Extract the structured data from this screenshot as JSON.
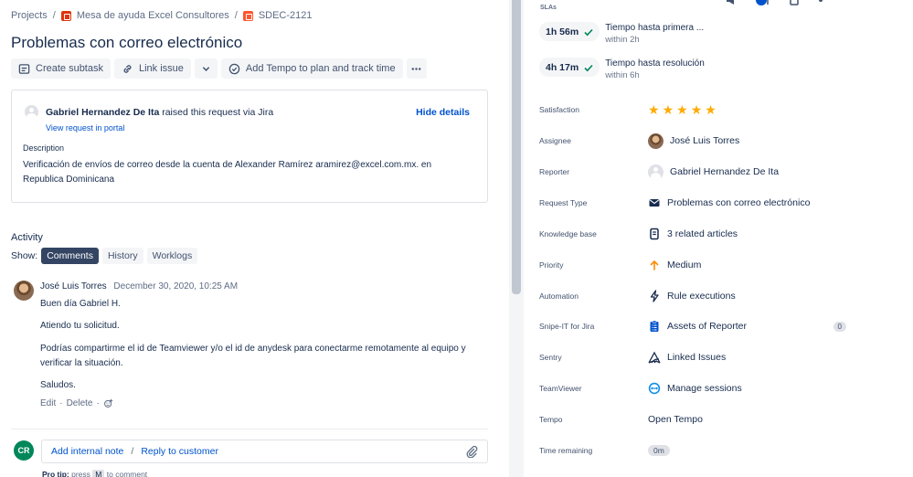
{
  "breadcrumbs": {
    "projects": "Projects",
    "project": "Mesa de ayuda Excel Consultores",
    "issue_key": "SDEC-2121"
  },
  "issue": {
    "title": "Problemas con correo electrónico"
  },
  "toolbar": {
    "create_subtask": "Create subtask",
    "link_issue": "Link issue",
    "tempo": "Add Tempo to plan and track time"
  },
  "details": {
    "reporter": "Gabriel Hernandez De Ita",
    "raised_text": "raised this request via",
    "channel": "Jira",
    "view_portal": "View request in portal",
    "hide_details": "Hide details",
    "description_label": "Description",
    "description": "Verificación de envíos de correo desde la cuenta de Alexander Ramírez aramirez@excel.com.mx. en Republica Dominicana"
  },
  "activity": {
    "label": "Activity",
    "show_label": "Show:",
    "tabs": [
      "Comments",
      "History",
      "Worklogs"
    ],
    "comment": {
      "author": "José Luis Torres",
      "date": "December 30, 2020, 10:25 AM",
      "lines": [
        "Buen día Gabriel H.",
        "Atiendo tu solicitud.",
        "Podrías compartirme el id de Teamviewer y/o el id de anydesk para conectarme remotamente al equipo y verificar la situación.",
        "Saludos."
      ],
      "edit": "Edit",
      "delete": "Delete",
      "dot": "·"
    }
  },
  "reply": {
    "avatar_initials": "CR",
    "internal_note": "Add internal note",
    "separator": "/",
    "reply_customer": "Reply to customer",
    "protip_prefix": "Pro tip:",
    "protip_text": "press",
    "protip_key": "M",
    "protip_suffix": "to comment"
  },
  "sidebar": {
    "slas_label": "SLAs",
    "slas": [
      {
        "time": "1h 56m",
        "name": "Tiempo hasta primera ...",
        "target": "within 2h"
      },
      {
        "time": "4h 17m",
        "name": "Tiempo hasta resolución",
        "target": "within 6h"
      }
    ],
    "fields": {
      "satisfaction": {
        "label": "Satisfaction",
        "rating": 5,
        "max": 5
      },
      "assignee": {
        "label": "Assignee",
        "value": "José Luis Torres"
      },
      "reporter": {
        "label": "Reporter",
        "value": "Gabriel Hernandez De Ita"
      },
      "request_type": {
        "label": "Request Type",
        "value": "Problemas con correo electrónico"
      },
      "knowledge_base": {
        "label": "Knowledge base",
        "value": "3 related articles"
      },
      "priority": {
        "label": "Priority",
        "value": "Medium"
      },
      "automation": {
        "label": "Automation",
        "value": "Rule executions"
      },
      "snipeit": {
        "label": "Snipe-IT for Jira",
        "value": "Assets of Reporter",
        "count": "0"
      },
      "sentry": {
        "label": "Sentry",
        "value": "Linked Issues"
      },
      "teamviewer": {
        "label": "TeamViewer",
        "value": "Manage sessions"
      },
      "tempo": {
        "label": "Tempo",
        "value": "Open Tempo"
      },
      "time_remaining": {
        "label": "Time remaining",
        "value": "0m"
      }
    }
  },
  "colors": {
    "link": "#0052cc",
    "star": "#ffab00",
    "sla_check": "#00875a",
    "priority_medium": "#ff8b00",
    "avatar_cr": "#00875a"
  }
}
